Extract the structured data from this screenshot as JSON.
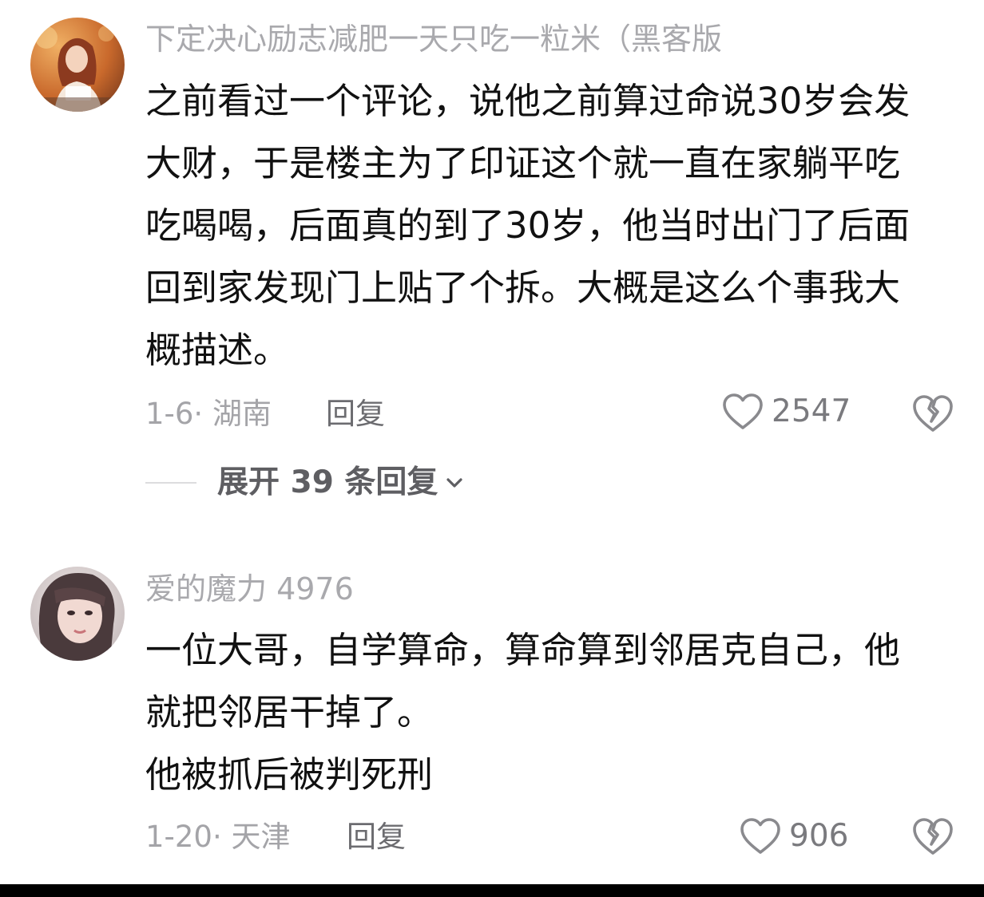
{
  "comments": [
    {
      "username": "下定决心励志减肥一天只吃一粒米（黑客版",
      "avatar_icon": "user-avatar-woman-reading",
      "lines": [
        "之前看过一个评论，说他之前算过命说30岁会发",
        "大财，于是楼主为了印证这个就一直在家躺平吃",
        "吃喝喝，后面真的到了30岁，他当时出门了后面",
        "回到家发现门上贴了个拆。大概是这么个事我大",
        "概描述。"
      ],
      "meta": "1-6· 湖南",
      "reply_label": "回复",
      "likes": "2547",
      "expand_label": "展开 39 条回复"
    },
    {
      "username": "爱的魔力 4976",
      "avatar_icon": "user-avatar-woman-portrait",
      "lines": [
        "一位大哥，自学算命，算命算到邻居克自己，他",
        "就把邻居干掉了。",
        "他被抓后被判死刑"
      ],
      "meta": "1-20· 天津",
      "reply_label": "回复",
      "likes": "906"
    }
  ],
  "icons": {
    "like": "heart-outline-icon",
    "dislike": "broken-heart-icon",
    "expand": "chevron-down-icon"
  },
  "colors": {
    "username": "#a9a9ad",
    "body": "#111111",
    "meta": "#a4a4a8",
    "reply": "#6c6c70",
    "expand": "#5e5e62"
  }
}
